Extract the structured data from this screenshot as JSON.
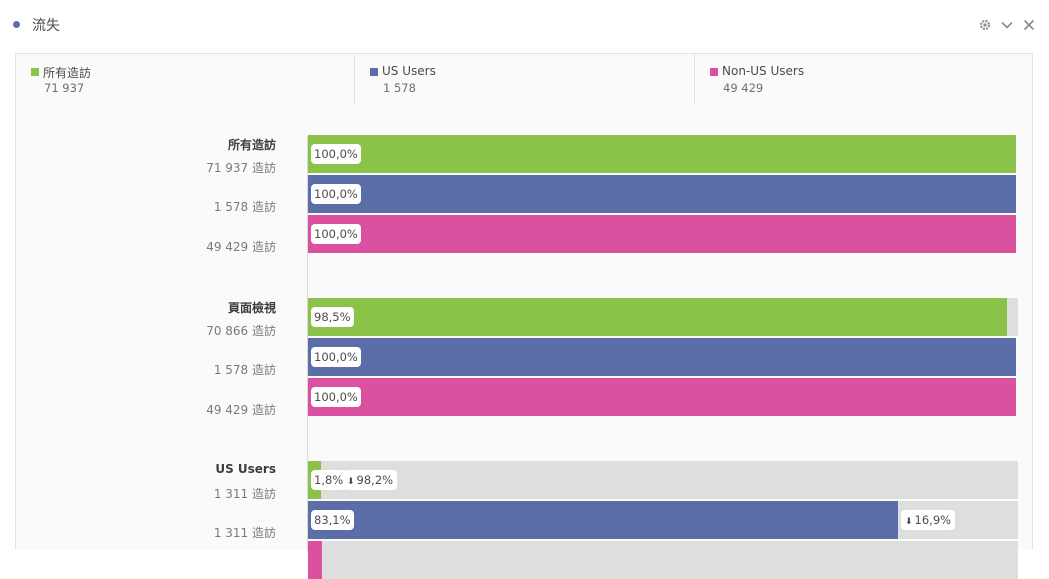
{
  "header": {
    "title": "流失",
    "icons": [
      "gear-icon",
      "chevron-down-icon",
      "close-icon"
    ]
  },
  "legend": [
    {
      "name": "所有造訪",
      "value": "71 937",
      "color": "#8bc34a"
    },
    {
      "name": "US Users",
      "value": "1 578",
      "color": "#5b6ea8"
    },
    {
      "name": "Non-US Users",
      "value": "49 429",
      "color": "#d9519f"
    }
  ],
  "chart_data": {
    "type": "bar",
    "orientation": "horizontal",
    "series_colors": [
      "#8bc34a",
      "#5b6ea8",
      "#d9519f"
    ],
    "track_color": "#dedede",
    "groups": [
      {
        "name": "所有造訪",
        "rows": [
          {
            "count": "71 937 造訪",
            "percent": 100.0,
            "pct_label": "100,0%",
            "drop_label": ""
          },
          {
            "count": "1 578 造訪",
            "percent": 100.0,
            "pct_label": "100,0%",
            "drop_label": ""
          },
          {
            "count": "49 429 造訪",
            "percent": 100.0,
            "pct_label": "100,0%",
            "drop_label": ""
          }
        ]
      },
      {
        "name": "頁面檢視",
        "rows": [
          {
            "count": "70 866 造訪",
            "percent": 98.5,
            "pct_label": "98,5%",
            "drop_label": ""
          },
          {
            "count": "1 578 造訪",
            "percent": 100.0,
            "pct_label": "100,0%",
            "drop_label": ""
          },
          {
            "count": "49 429 造訪",
            "percent": 100.0,
            "pct_label": "100,0%",
            "drop_label": ""
          }
        ]
      },
      {
        "name": "US Users",
        "rows": [
          {
            "count": "1 311 造訪",
            "percent": 1.8,
            "pct_label": "1,8%",
            "drop_label": "98,2%"
          },
          {
            "count": "1 311 造訪",
            "percent": 83.1,
            "pct_label": "83,1%",
            "drop_label": "16,9%"
          },
          {
            "count": "",
            "percent": 2.0,
            "pct_label": "",
            "drop_label": ""
          }
        ]
      }
    ]
  }
}
